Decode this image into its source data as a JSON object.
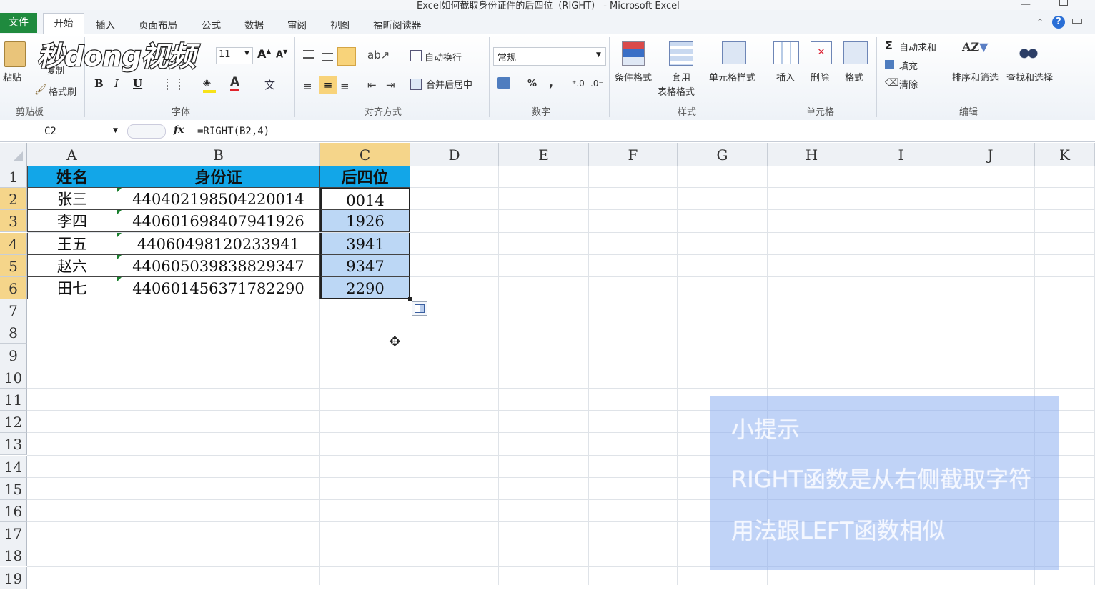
{
  "window": {
    "title": "Excel如何截取身份证件的后四位（RIGHT） - Microsoft Excel"
  },
  "tabs": [
    "开始",
    "插入",
    "页面布局",
    "公式",
    "数据",
    "审阅",
    "视图",
    "福昕阅读器"
  ],
  "file_tab": "文件",
  "ribbon": {
    "clipboard": {
      "paste": "粘贴",
      "copy": "复制",
      "format_painter": "格式刷",
      "group": "剪贴板"
    },
    "font": {
      "size": "11",
      "group": "字体",
      "bold": "B",
      "italic": "I",
      "underline": "U"
    },
    "alignment": {
      "wrap": "自动换行",
      "merge": "合并后居中",
      "group": "对齐方式"
    },
    "number": {
      "format": "常规",
      "group": "数字",
      "percent": "%",
      "comma": ","
    },
    "styles": {
      "conditional": "条件格式",
      "table_line1": "套用",
      "table_line2": "表格格式",
      "cell_styles": "单元格样式",
      "group": "样式"
    },
    "cells": {
      "insert": "插入",
      "delete": "删除",
      "format": "格式",
      "group": "单元格"
    },
    "editing": {
      "autosum": "自动求和",
      "fill": "填充",
      "clear": "清除",
      "sort": "排序和筛选",
      "find": "查找和选择",
      "group": "编辑"
    }
  },
  "formula_bar": {
    "name_box": "C2",
    "fx": "fx",
    "formula": "=RIGHT(B2,4)"
  },
  "columns": [
    "A",
    "B",
    "C",
    "D",
    "E",
    "F",
    "G",
    "H",
    "I",
    "J",
    "K"
  ],
  "rows": [
    "1",
    "2",
    "3",
    "4",
    "5",
    "6",
    "7",
    "8",
    "9",
    "10",
    "11",
    "12",
    "13",
    "14",
    "15",
    "16",
    "17",
    "18",
    "19"
  ],
  "table": {
    "headers": [
      "姓名",
      "身份证",
      "后四位"
    ],
    "rows": [
      [
        "张三",
        "440402198504220014",
        "0014"
      ],
      [
        "李四",
        "440601698407941926",
        "1926"
      ],
      [
        "王五",
        "44060498120233941",
        "3941"
      ],
      [
        "赵六",
        "440605039838829347",
        "9347"
      ],
      [
        "田七",
        "440601456371782290",
        "2290"
      ]
    ]
  },
  "tip": {
    "title": "小提示",
    "line1": "RIGHT函数是从右侧截取字符",
    "line2": "用法跟LEFT函数相似"
  },
  "watermark": "秒dong视频",
  "colors": {
    "header_fill": "#12a6e8",
    "selection_fill": "#bcd7f5",
    "active_header": "#f5d58a",
    "file_tab": "#1f8a3e"
  }
}
